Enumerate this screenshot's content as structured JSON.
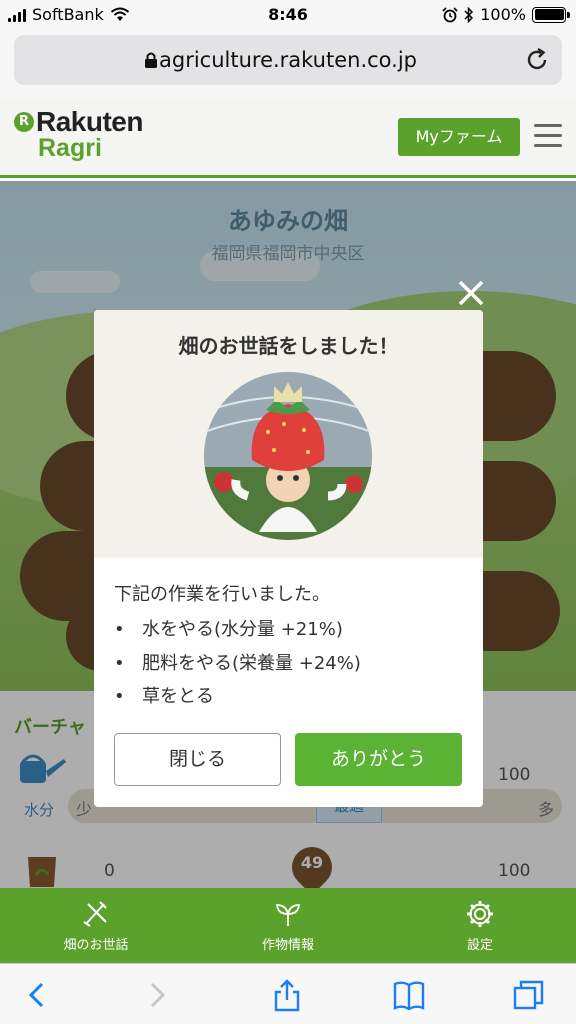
{
  "status_bar": {
    "carrier": "SoftBank",
    "time": "8:46",
    "battery": "100%"
  },
  "browser": {
    "url": "agriculture.rakuten.co.jp"
  },
  "header": {
    "logo_line1": "Rakuten",
    "logo_line2": "Ragri",
    "logo_badge": "R",
    "myfarm_label": "Myファーム"
  },
  "farm": {
    "title": "あゆみの畑",
    "location": "福岡県福岡市中央区"
  },
  "status_panel": {
    "heading": "バーチャ",
    "water_label": "水分",
    "water_min_label": "少",
    "water_max_label": "多",
    "optimal_label": "最適",
    "water_scale_max": "100",
    "fert_scale_min": "0",
    "fert_scale_max": "100",
    "fert_value": "49"
  },
  "modal": {
    "title": "畑のお世話をしました！",
    "message": "下記の作業を行いました。",
    "bullet": "•",
    "tasks": [
      "水をやる(水分量 +21%)",
      "肥料をやる(栄養量 +24%)",
      "草をとる"
    ],
    "close_button": "閉じる",
    "thanks_button": "ありがとう"
  },
  "tabs": [
    {
      "label": "畑のお世話",
      "icon": "farm-tools-icon"
    },
    {
      "label": "作物情報",
      "icon": "sprout-icon"
    },
    {
      "label": "設定",
      "icon": "gear-icon"
    }
  ],
  "colors": {
    "brand_green": "#5ba22c",
    "button_green": "#5bb336",
    "soil_brown": "#6b4a2c"
  }
}
